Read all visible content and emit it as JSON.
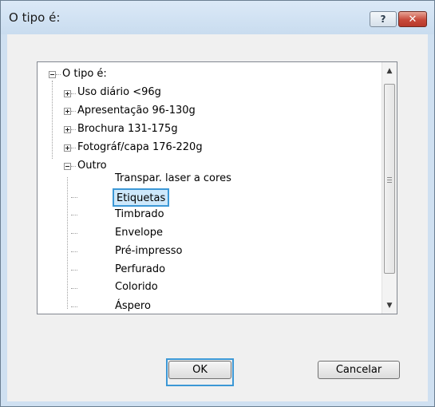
{
  "window": {
    "title": "O tipo é:",
    "help_label": "?",
    "close_label": "✕"
  },
  "tree": {
    "root": {
      "label": "O tipo é:",
      "expander": "−"
    },
    "groups": [
      {
        "label": "Uso diário <96g",
        "expander": "+"
      },
      {
        "label": "Apresentação 96-130g",
        "expander": "+"
      },
      {
        "label": "Brochura 131-175g",
        "expander": "+"
      },
      {
        "label": "Fotográf/capa 176-220g",
        "expander": "+"
      },
      {
        "label": "Outro",
        "expander": "−"
      }
    ],
    "children": [
      {
        "label": "Transpar. laser a cores"
      },
      {
        "label": "Etiquetas",
        "selected": true
      },
      {
        "label": "Timbrado"
      },
      {
        "label": "Envelope"
      },
      {
        "label": "Pré-impresso"
      },
      {
        "label": "Perfurado"
      },
      {
        "label": "Colorido"
      },
      {
        "label": "Áspero"
      }
    ]
  },
  "scrollbar": {
    "up": "▲",
    "down": "▼"
  },
  "buttons": {
    "ok": "OK",
    "cancel": "Cancelar"
  },
  "colors": {
    "selection_border": "#3c98d6",
    "selection_fill": "#cde8fb",
    "close_red": "#c7493a"
  }
}
